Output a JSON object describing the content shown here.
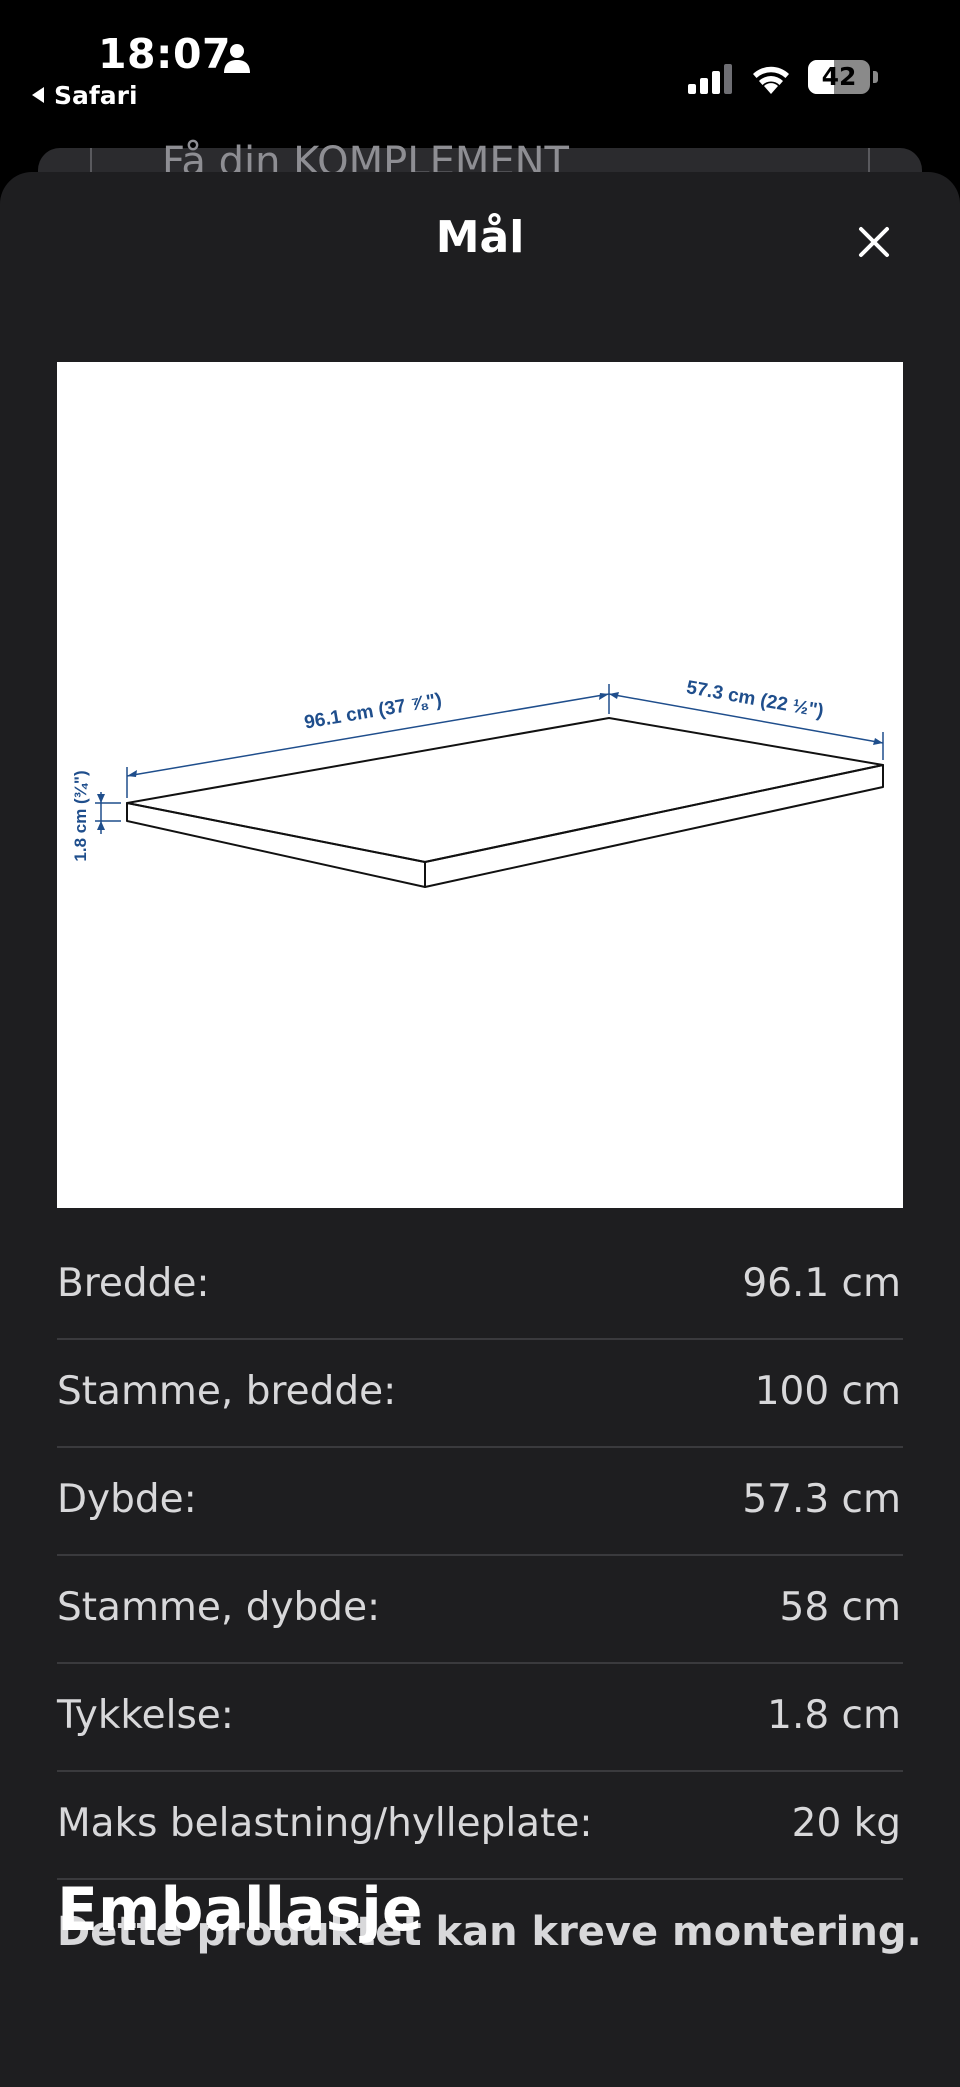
{
  "status_bar": {
    "time": "18:07",
    "back_app": "Safari",
    "battery_level": "42",
    "battery_fraction": 0.42,
    "icons": [
      "person-icon",
      "back-arrow-icon",
      "signal-icon",
      "wifi-icon",
      "battery-icon"
    ]
  },
  "background_page": {
    "peek_text": "Få din KOMPLEMENT"
  },
  "sheet": {
    "title": "Mål",
    "close_icon": "close-icon"
  },
  "diagram": {
    "width_label": "96.1 cm (37 ⅞\")",
    "depth_label": "57.3 cm (22 ½\")",
    "thickness_label": "1.8 cm (¾\")",
    "line_color": "#1f4e8c"
  },
  "specs": [
    {
      "label": "Bredde:",
      "value": "96.1 cm"
    },
    {
      "label": "Stamme, bredde:",
      "value": "100 cm"
    },
    {
      "label": "Dybde:",
      "value": "57.3 cm"
    },
    {
      "label": "Stamme, dybde:",
      "value": "58 cm"
    },
    {
      "label": "Tykkelse:",
      "value": "1.8 cm"
    },
    {
      "label": "Maks belastning/hylleplate:",
      "value": "20 kg"
    }
  ],
  "assembly_note": "Dette produktet kan kreve montering.",
  "next_section_heading": "Emballasje"
}
